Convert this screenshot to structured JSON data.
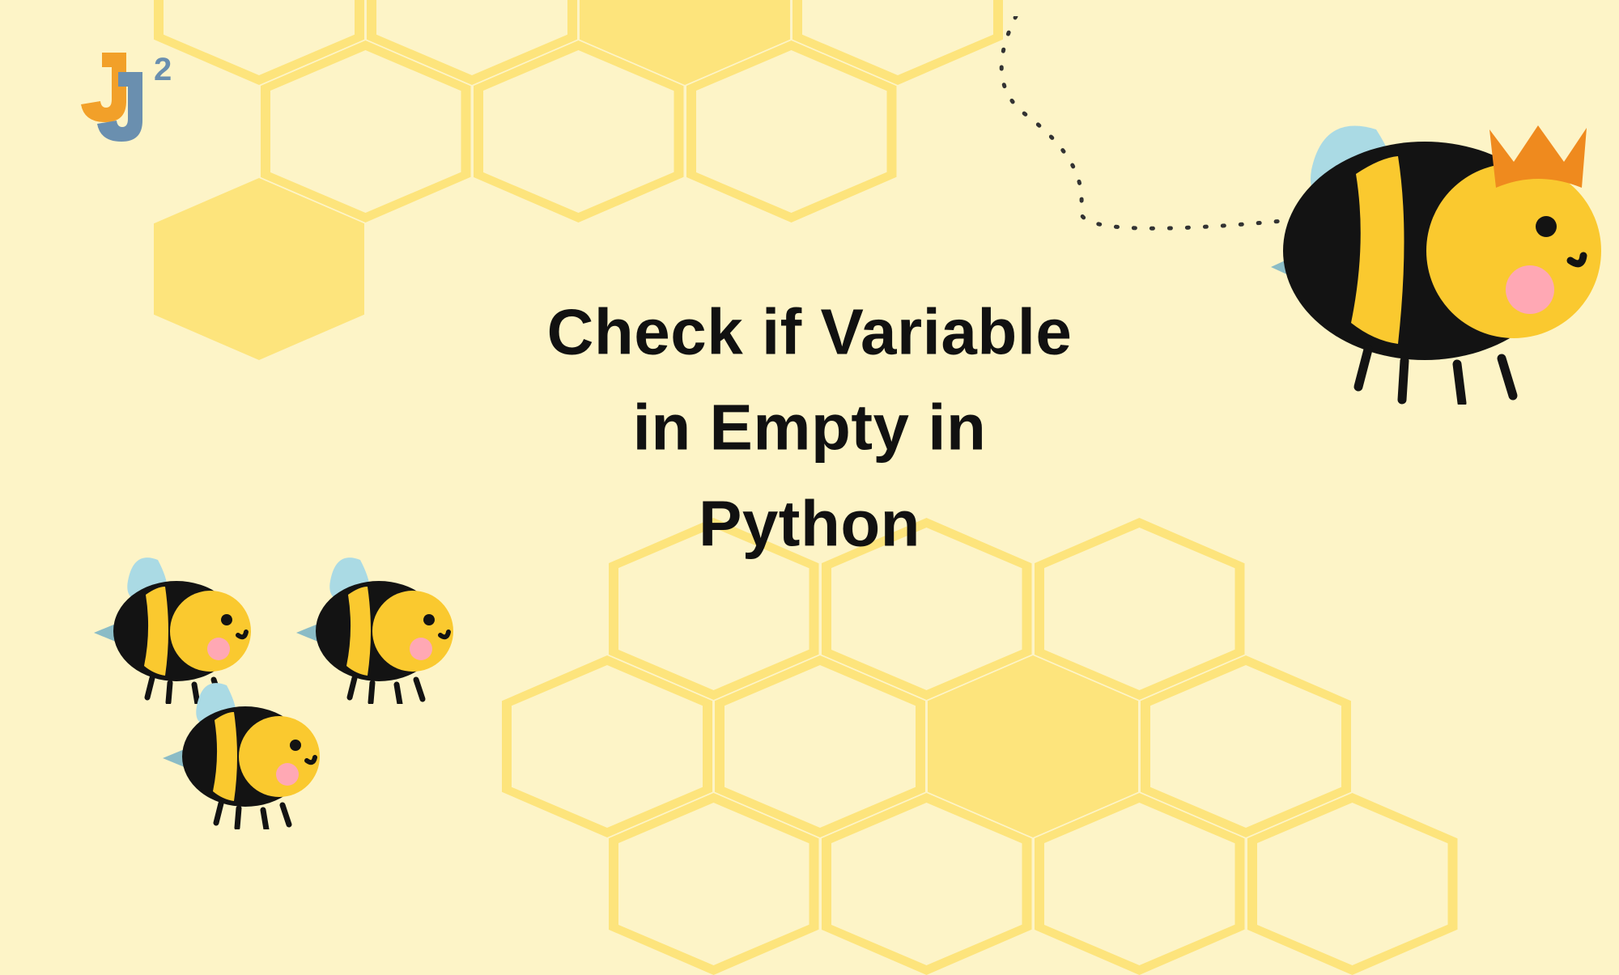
{
  "logo": {
    "primary_color": "#F2A029",
    "secondary_color": "#6A8FAF",
    "superscript": "2"
  },
  "headline": {
    "line1": "Check if Variable",
    "line2": "in Empty in",
    "line3": "Python"
  },
  "palette": {
    "bg": "#FDF4C7",
    "hex_fill": "#FDE47C",
    "bee_yellow": "#FAC92F",
    "bee_black": "#131313",
    "bee_cheek": "#FFA8B4",
    "wing": "#AADAE4",
    "crown": "#EF8A1E",
    "stinger": "#8BBCC6"
  }
}
